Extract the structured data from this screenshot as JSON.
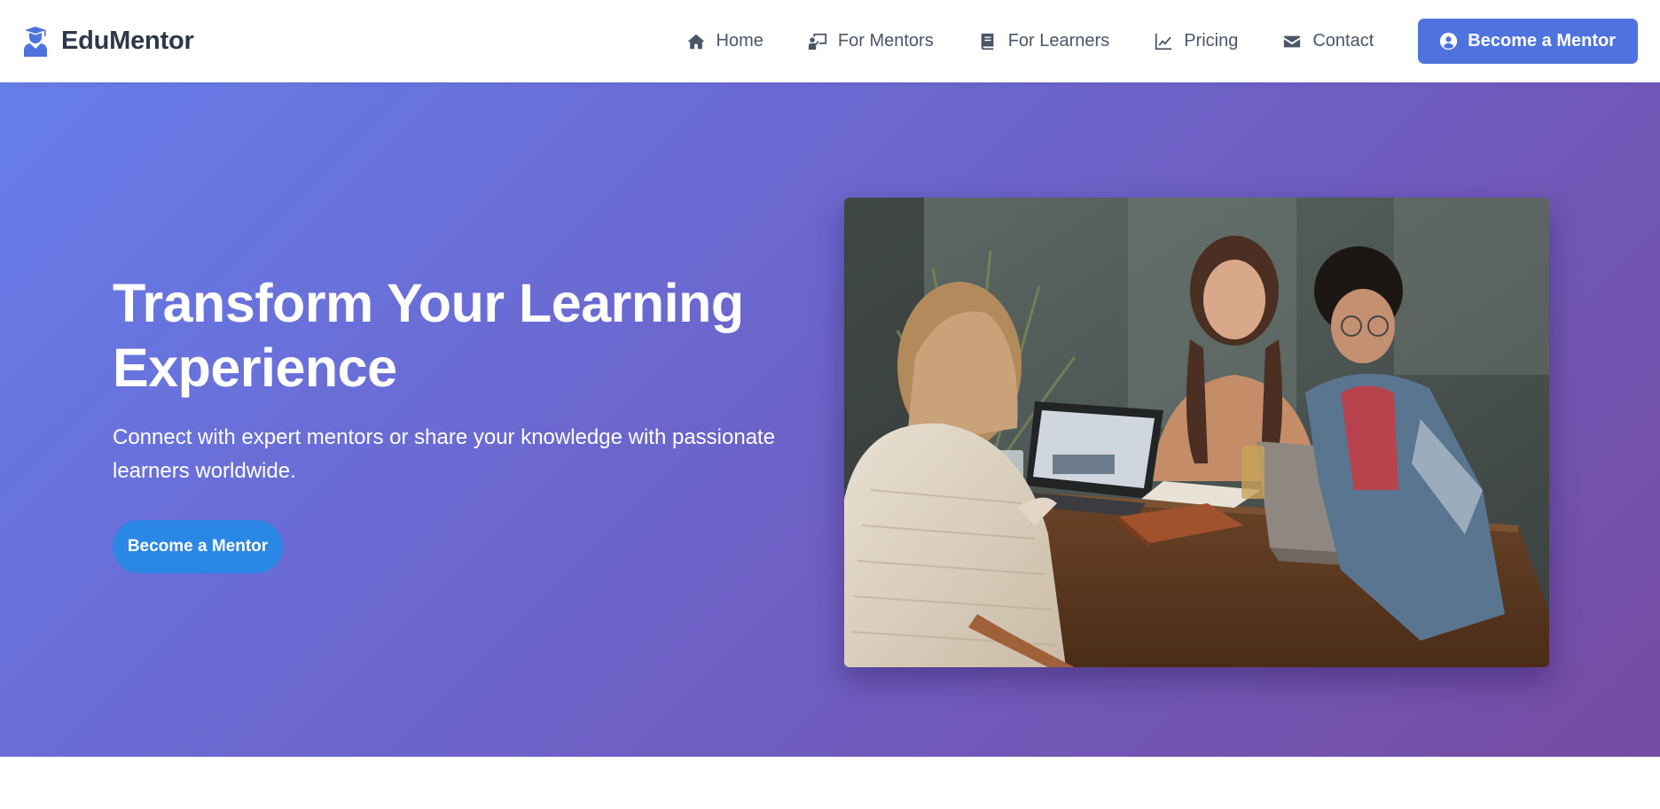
{
  "brand": {
    "name": "EduMentor",
    "icon": "graduate-icon",
    "color": "#4e73df"
  },
  "nav": {
    "items": [
      {
        "label": "Home",
        "icon": "home-icon"
      },
      {
        "label": "For Mentors",
        "icon": "chalkboard-teacher-icon"
      },
      {
        "label": "For Learners",
        "icon": "book-icon"
      },
      {
        "label": "Pricing",
        "icon": "chart-line-icon"
      },
      {
        "label": "Contact",
        "icon": "envelope-icon"
      }
    ],
    "cta": {
      "label": "Become a Mentor",
      "icon": "user-circle-icon",
      "color": "#4e73df"
    }
  },
  "hero": {
    "title": "Transform Your Learning Experience",
    "subtitle": "Connect with expert mentors or share your knowledge with passionate learners worldwide.",
    "cta": {
      "label": "Become a Mentor",
      "color": "#2b87e6"
    },
    "gradient": [
      "#667eea",
      "#764ba2"
    ],
    "image": {
      "subject": "three-people-laughing-at-table-with-laptops"
    }
  }
}
